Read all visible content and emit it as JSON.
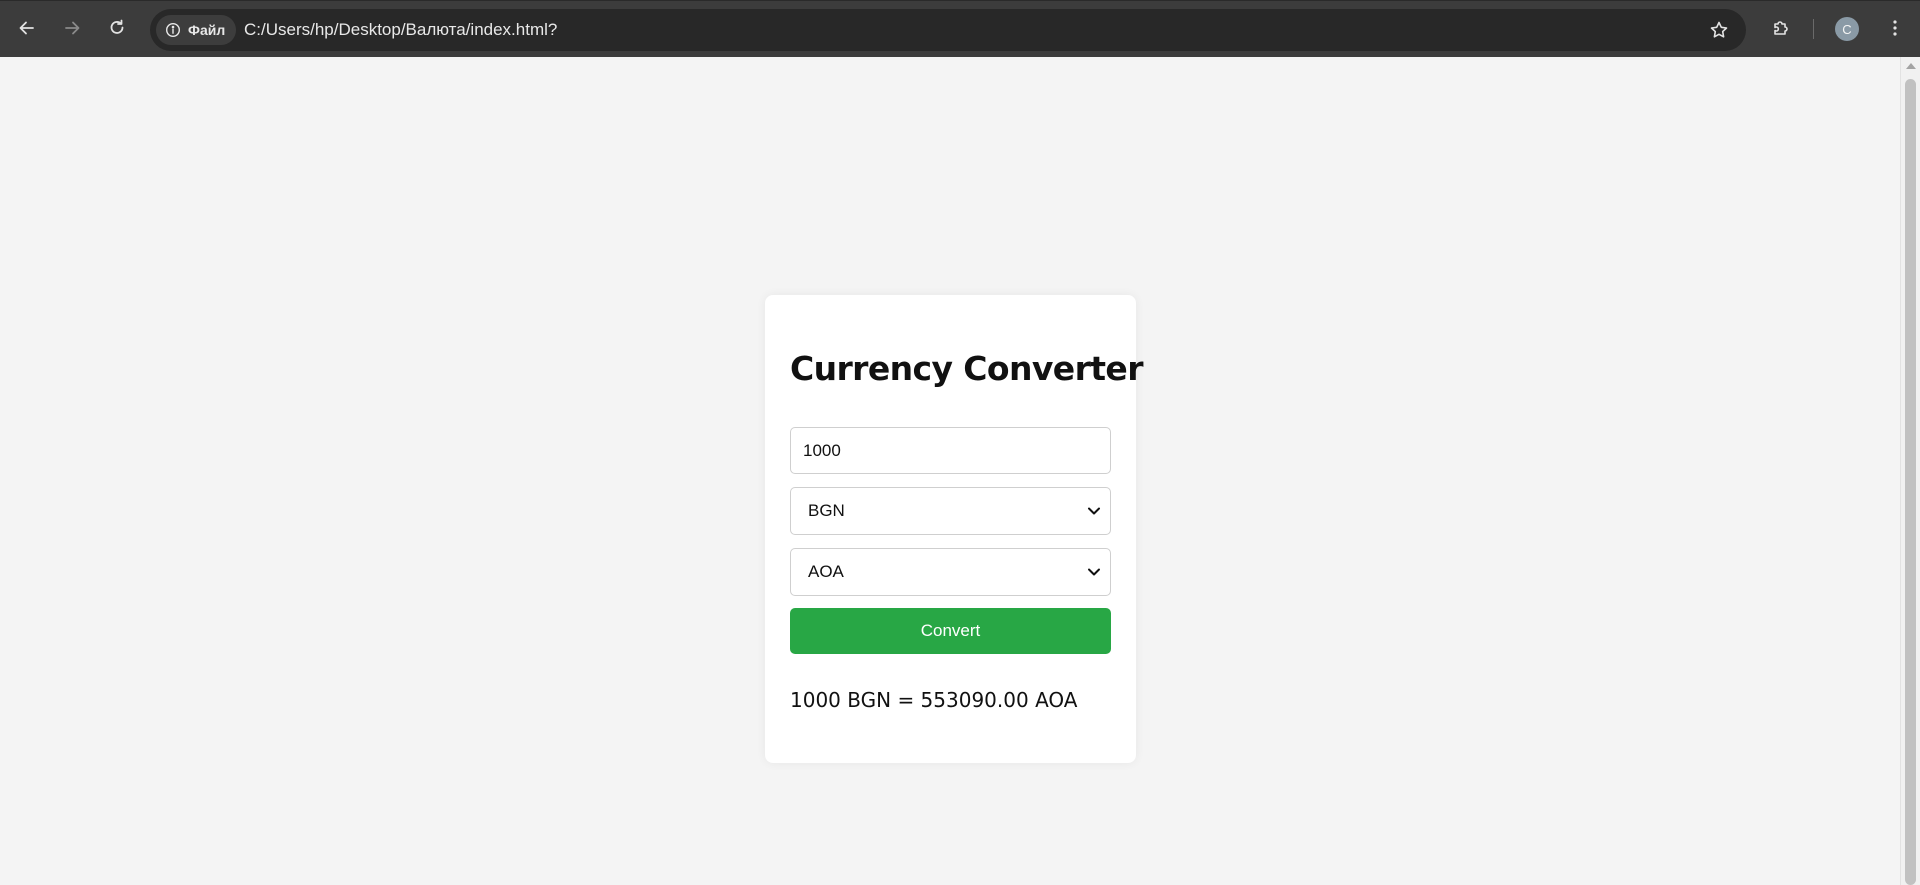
{
  "browser": {
    "site_chip_label": "Файл",
    "url": "C:/Users/hp/Desktop/Валюта/index.html?",
    "avatar_letter": "C"
  },
  "page": {
    "title": "Currency Converter",
    "amount_value": "1000",
    "from_currency": "BGN",
    "to_currency": "AOA",
    "convert_label": "Convert",
    "result_text": "1000 BGN = 553090.00 AOA",
    "accent_color": "#28a745"
  }
}
